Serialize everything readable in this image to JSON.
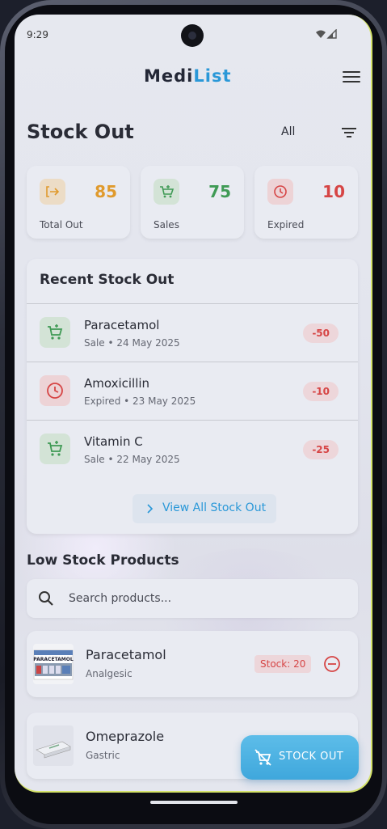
{
  "status_bar": {
    "time": "9:29"
  },
  "header": {
    "logo_part1": "Medi",
    "logo_part2": "List"
  },
  "page": {
    "title": "Stock Out",
    "filter_label": "All"
  },
  "stats": [
    {
      "value": "85",
      "label": "Total Out",
      "icon": "exit-icon",
      "color": "#e09a2d"
    },
    {
      "value": "75",
      "label": "Sales",
      "icon": "cart-icon",
      "color": "#3f9a55"
    },
    {
      "value": "10",
      "label": "Expired",
      "icon": "clock-icon",
      "color": "#d64545"
    }
  ],
  "recent": {
    "title": "Recent Stock Out",
    "items": [
      {
        "name": "Paracetamol",
        "sub": "Sale • 24 May 2025",
        "qty": "-50",
        "type": "sale"
      },
      {
        "name": "Amoxicillin",
        "sub": "Expired • 23 May 2025",
        "qty": "-10",
        "type": "expired"
      },
      {
        "name": "Vitamin C",
        "sub": "Sale • 22 May 2025",
        "qty": "-25",
        "type": "sale"
      }
    ],
    "view_all": "View All Stock Out"
  },
  "low_stock": {
    "title": "Low Stock Products",
    "search_placeholder": "Search products...",
    "products": [
      {
        "name": "Paracetamol",
        "category": "Analgesic",
        "stock": "Stock: 20",
        "thumb_text": "PARACETAMOL"
      },
      {
        "name": "Omeprazole",
        "category": "Gastric"
      }
    ]
  },
  "fab": {
    "label": "STOCK OUT"
  },
  "colors": {
    "accent": "#2a98d8",
    "danger": "#d64545",
    "success": "#3f9a55",
    "warning": "#e09a2d"
  }
}
